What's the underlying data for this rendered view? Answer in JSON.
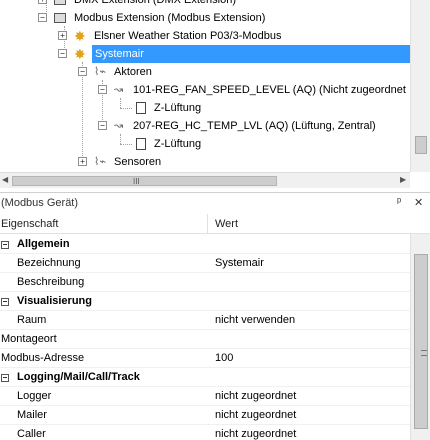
{
  "tree": {
    "nodes": [
      {
        "label": "DMX Extension (DMX Extension)",
        "icon": "dmx-device-icon",
        "expander": "+"
      },
      {
        "label": "Modbus Extension (Modbus Extension)",
        "icon": "modbus-device-icon",
        "expander": "−"
      },
      {
        "label": "Elsner Weather Station P03/3-Modbus",
        "icon": "gear-icon",
        "expander": "+"
      },
      {
        "label": "Systemair",
        "icon": "gear-icon",
        "expander": "−",
        "selected": true
      },
      {
        "label": "Aktoren",
        "icon": "actuator-folder-icon",
        "expander": "−"
      },
      {
        "label": "101-REG_FAN_SPEED_LEVEL (AQ) (Nicht zugeordnet",
        "icon": "analog-output-icon",
        "expander": "−"
      },
      {
        "label": "Z-Lüftung",
        "icon": "document-icon"
      },
      {
        "label": "207-REG_HC_TEMP_LVL (AQ) (Lüftung, Zentral)",
        "icon": "analog-output-icon",
        "expander": "−"
      },
      {
        "label": "Z-Lüftung",
        "icon": "document-icon"
      },
      {
        "label": "Sensoren",
        "icon": "sensor-folder-icon",
        "expander": "+"
      }
    ],
    "hscroll_grip": "III"
  },
  "properties": {
    "title": "(Modbus Gerät)",
    "pin_label": "ᵖ",
    "close_label": "✕",
    "columns": {
      "property": "Eigenschaft",
      "value": "Wert"
    },
    "rows": [
      {
        "type": "category",
        "key": "Allgemein"
      },
      {
        "type": "item",
        "key": "Bezeichnung",
        "value": "Systemair"
      },
      {
        "type": "item",
        "key": "Beschreibung",
        "value": ""
      },
      {
        "type": "category",
        "key": "Visualisierung"
      },
      {
        "type": "item",
        "key": "Raum",
        "value": "nicht verwenden"
      },
      {
        "type": "plain",
        "key": "Montageort",
        "value": ""
      },
      {
        "type": "plain",
        "key": "Modbus-Adresse",
        "value": "100"
      },
      {
        "type": "category",
        "key": "Logging/Mail/Call/Track"
      },
      {
        "type": "item",
        "key": "Logger",
        "value": "nicht zugeordnet"
      },
      {
        "type": "item",
        "key": "Mailer",
        "value": "nicht zugeordnet"
      },
      {
        "type": "item",
        "key": "Caller",
        "value": "nicht zugeordnet"
      }
    ]
  },
  "colors": {
    "selection": "#3399ff",
    "gear": "#e3a21a"
  }
}
